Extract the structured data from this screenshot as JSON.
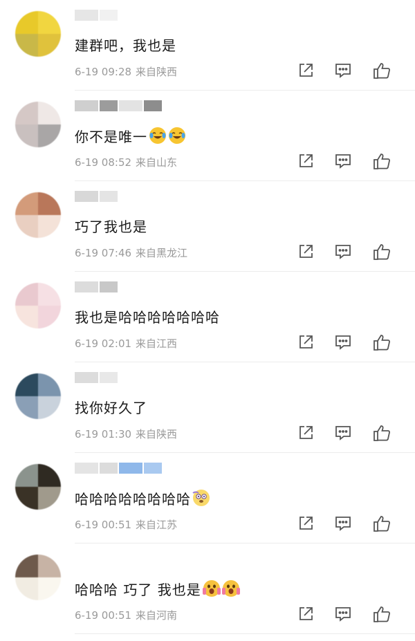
{
  "colors": {
    "text": "#1a1a1a",
    "meta": "#9a9a9a",
    "icon": "#555555",
    "divider": "#ececec"
  },
  "comments": [
    {
      "text": "建群吧，我也是",
      "time": "6-19 09:28",
      "location": "来自陕西",
      "avatar_colors": [
        "#e8c92a",
        "#f1d640",
        "#c9b848",
        "#e0c23c"
      ],
      "nickname_blocks": [
        "#e6e6e6",
        "#f1f1f1"
      ],
      "emojis": []
    },
    {
      "text": "你不是唯一",
      "time": "6-19 08:52",
      "location": "来自山东",
      "avatar_colors": [
        "#d5c8c6",
        "#efe8e6",
        "#c9c0bf",
        "#a9a6a6"
      ],
      "nickname_blocks": [
        "#cfcfcf",
        "#9c9c9c",
        "#e3e3e3",
        "#8d8d8d"
      ],
      "emojis": [
        "crying-laughing-emoji",
        "crying-laughing-emoji"
      ]
    },
    {
      "text": "巧了我也是",
      "time": "6-19 07:46",
      "location": "来自黑龙江",
      "avatar_colors": [
        "#d39b7a",
        "#b9775a",
        "#e9cfc1",
        "#f4e2d8"
      ],
      "nickname_blocks": [
        "#d8d8d8",
        "#e4e4e4"
      ],
      "emojis": []
    },
    {
      "text": "我也是哈哈哈哈哈哈哈",
      "time": "6-19 02:01",
      "location": "来自江西",
      "avatar_colors": [
        "#e9c9cf",
        "#f6e0e4",
        "#f7e4de",
        "#f2d5dc"
      ],
      "nickname_blocks": [
        "#dcdcdc",
        "#c8c8c8"
      ],
      "emojis": []
    },
    {
      "text": "找你好久了",
      "time": "6-19 01:30",
      "location": "来自陕西",
      "avatar_colors": [
        "#2c4a5e",
        "#7b94ad",
        "#8a9fb6",
        "#c9d2dc"
      ],
      "nickname_blocks": [
        "#dcdcdc",
        "#e8e8e8"
      ],
      "emojis": []
    },
    {
      "text": "哈哈哈哈哈哈哈哈",
      "time": "6-19 00:51",
      "location": "来自江苏",
      "avatar_colors": [
        "#8b938d",
        "#2f2a22",
        "#3a3226",
        "#a09a8c"
      ],
      "nickname_blocks": [
        "#e4e4e4",
        "#dcdcdc",
        "#8fb8ea",
        "#a9c9f0"
      ],
      "emojis": [
        "dizzy-face-emoji"
      ]
    },
    {
      "text": "哈哈哈 巧了 我也是",
      "time": "6-19 00:51",
      "location": "来自河南",
      "avatar_colors": [
        "#6e5a4c",
        "#c7b3a5",
        "#f1ece2",
        "#faf7ef"
      ],
      "nickname_blocks": [],
      "emojis": [
        "screaming-face-emoji",
        "screaming-face-emoji"
      ]
    }
  ]
}
